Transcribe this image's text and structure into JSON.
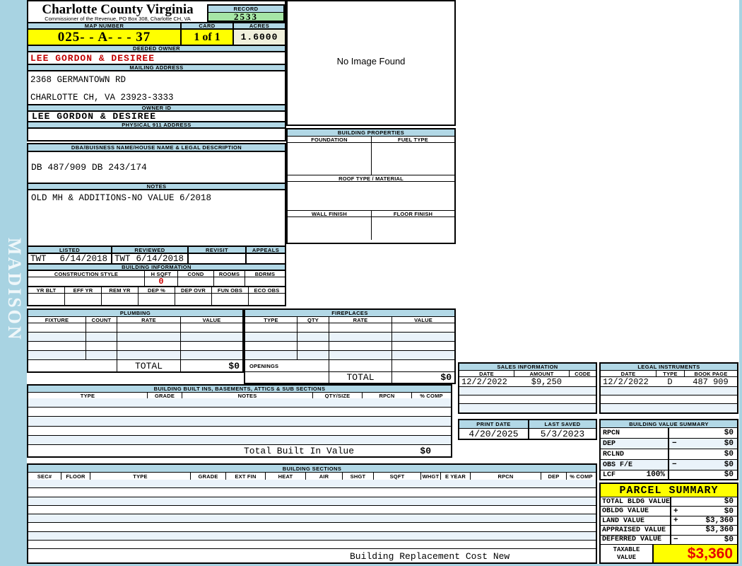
{
  "colors": {
    "page_blue": "#A8D3E2",
    "header_blue": "#B2D8E6",
    "row_pale_blue": "#EAF3FA",
    "highlight_yellow": "#FFFF00",
    "record_green": "#A6E6A6",
    "acres_cream": "#F0F0DC",
    "owner_red": "#C00000",
    "taxable_red": "#E60000"
  },
  "watermark": "MADISON",
  "title": {
    "county": "Charlotte County Virginia",
    "commissioner": "Commissioner of the Revenue, PO Box 308, Charlotte CH, VA",
    "record_label": "RECORD",
    "record_value": "2533"
  },
  "map": {
    "map_number_label": "MAP NUMBER",
    "map_number": "025- - A- - - 37",
    "card_label": "CARD",
    "card": "1 of 1",
    "acres_label": "ACRES",
    "acres": "1.6000"
  },
  "owner": {
    "deeded_owner_label": "DEEDED OWNER",
    "deeded_owner": "LEE GORDON & DESIREE",
    "mailing_address_label": "MAILING ADDRESS",
    "address_line1": "2368 GERMANTOWN RD",
    "address_line2": "CHARLOTTE CH, VA 23923-3333",
    "owner_id_label": "OWNER ID",
    "owner_id": "LEE GORDON & DESIREE",
    "physical_address_label": "PHYSICAL 911 ADDRESS",
    "physical_address": ""
  },
  "legal_desc": {
    "label": "DBA/BUISNESS NAME/HOUSE NAME & LEGAL DESCRIPTION",
    "value": "DB 487/909 DB 243/174",
    "notes_label": "NOTES",
    "notes": "OLD MH & ADDITIONS-NO VALUE 6/2018"
  },
  "review": {
    "listed_label": "LISTED",
    "reviewed_label": "REVIEWED",
    "revisit_label": "REVISIT",
    "appeals_label": "APPEALS",
    "listed_by": "TWT",
    "listed_date": "6/14/2018",
    "reviewed_by": "TWT",
    "reviewed_date": "6/14/2018",
    "revisit": "",
    "appeals": ""
  },
  "building_info": {
    "title": "BUILDING INFORMATION",
    "headers1": [
      "CONSTRUCTION STYLE",
      "H SQFT",
      "COND",
      "ROOMS",
      "BDRMS"
    ],
    "h_sqft": "0",
    "headers2": [
      "YR BLT",
      "EFF YR",
      "REM YR",
      "DEP %",
      "DEP OVR",
      "FUN OBS",
      "ECO OBS"
    ]
  },
  "plumbing": {
    "title": "PLUMBING",
    "headers": [
      "FIXTURE",
      "COUNT",
      "RATE",
      "VALUE"
    ],
    "total_label": "TOTAL",
    "total_value": "$0"
  },
  "fireplaces": {
    "title": "FIREPLACES",
    "headers": [
      "TYPE",
      "QTY",
      "RATE",
      "VALUE"
    ],
    "openings_label": "OPENINGS",
    "total_label": "TOTAL",
    "total_value": "$0"
  },
  "built_ins": {
    "title": "BUILDING BUILT INS, BASEMENTS, ATTICS & SUB SECTIONS",
    "headers": [
      "TYPE",
      "GRADE",
      "NOTES",
      "QTY/SIZE",
      "RPCN",
      "% COMP"
    ],
    "total_label": "Total Built In Value",
    "total_value": "$0"
  },
  "building_sections": {
    "title": "BUILDING SECTIONS",
    "headers": [
      "SEC#",
      "FLOOR",
      "TYPE",
      "GRADE",
      "EXT FIN",
      "HEAT",
      "AIR",
      "SHGT",
      "SQFT",
      "WHGT",
      "E YEAR",
      "RPCN",
      "DEP",
      "% COMP"
    ],
    "footer": "Building Replacement Cost New"
  },
  "no_image": {
    "text": "No Image Found"
  },
  "building_properties": {
    "title": "BUILDING PROPERTIES",
    "foundation_label": "FOUNDATION",
    "fuel_type_label": "FUEL TYPE",
    "roof_label": "ROOF TYPE / MATERIAL",
    "wall_label": "WALL FINISH",
    "floor_label": "FLOOR FINISH"
  },
  "sales": {
    "title": "SALES INFORMATION",
    "headers": [
      "DATE",
      "AMOUNT",
      "CODE"
    ],
    "rows": [
      {
        "date": "12/2/2022",
        "amount": "$9,250",
        "code": ""
      }
    ]
  },
  "instruments": {
    "title": "LEGAL INSTRUMENTS",
    "headers": [
      "DATE",
      "TYPE",
      "BOOK PAGE"
    ],
    "rows": [
      {
        "date": "12/2/2022",
        "type": "D",
        "book_page": "487 909"
      }
    ]
  },
  "dates": {
    "print_label": "PRINT DATE",
    "print_date": "4/20/2025",
    "saved_label": "LAST SAVED",
    "saved_date": "5/3/2023"
  },
  "value_summary": {
    "title": "BUILDING VALUE SUMMARY",
    "rows": [
      {
        "label": "RPCN",
        "op": "",
        "value": "$0"
      },
      {
        "label": "DEP",
        "op": "−",
        "value": "$0"
      },
      {
        "label": "RCLND",
        "op": "",
        "value": "$0"
      },
      {
        "label": "OBS F/E",
        "op": "−",
        "value": "$0"
      },
      {
        "label": "LCF",
        "pct": "100%",
        "op": "",
        "value": "$0"
      }
    ]
  },
  "parcel_summary": {
    "title": "PARCEL SUMMARY",
    "rows": [
      {
        "label": "TOTAL BLDG VALUE",
        "op": "",
        "value": "$0"
      },
      {
        "label": "OBLDG VALUE",
        "op": "+",
        "value": "$0"
      },
      {
        "label": "LAND VALUE",
        "op": "+",
        "value": "$3,360"
      },
      {
        "label": "APPRAISED VALUE",
        "op": "",
        "value": "$3,360"
      },
      {
        "label": "DEFERRED VALUE",
        "op": "−",
        "value": "$0"
      }
    ],
    "taxable_label_1": "TAXABLE",
    "taxable_label_2": "VALUE",
    "taxable_value": "$3,360"
  }
}
